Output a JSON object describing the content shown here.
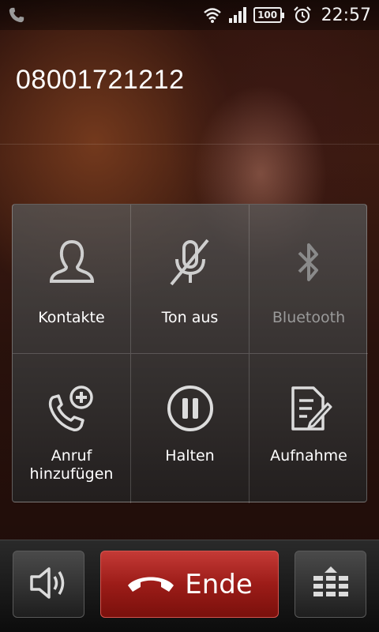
{
  "status_bar": {
    "left_icon": "phone-icon",
    "icons": [
      "wifi-icon",
      "signal-icon",
      "battery-icon",
      "alarm-icon"
    ],
    "battery_level": "100",
    "time": "22:57"
  },
  "call": {
    "number": "08001721212"
  },
  "actions": [
    {
      "label": "Kontakte",
      "icon": "contacts-icon",
      "enabled": true
    },
    {
      "label": "Ton aus",
      "icon": "mute-mic-icon",
      "enabled": true
    },
    {
      "label": "Bluetooth",
      "icon": "bluetooth-icon",
      "enabled": false
    },
    {
      "label": "Anruf\nhinzufügen",
      "label_line1": "Anruf",
      "label_line2": "hinzufügen",
      "icon": "add-call-icon",
      "enabled": true
    },
    {
      "label": "Halten",
      "icon": "pause-icon",
      "enabled": true
    },
    {
      "label": "Aufnahme",
      "icon": "record-note-icon",
      "enabled": true
    }
  ],
  "bottom_bar": {
    "speaker_icon": "speaker-icon",
    "end_label": "Ende",
    "end_icon": "hangup-icon",
    "dialpad_icon": "dialpad-icon"
  },
  "colors": {
    "end_button": "#9c1c18",
    "disabled_text": "#9a9a9a"
  }
}
